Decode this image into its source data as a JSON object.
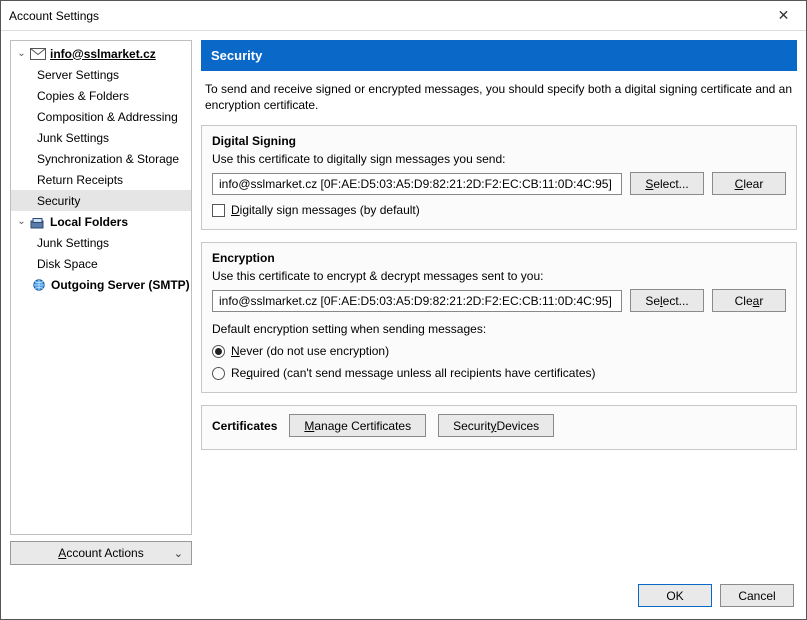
{
  "window": {
    "title": "Account Settings",
    "close_glyph": "✕"
  },
  "sidebar": {
    "account_email": "info@sslmarket.cz",
    "items": {
      "server_settings": "Server Settings",
      "copies_folders": "Copies & Folders",
      "composition_addressing": "Composition & Addressing",
      "junk_settings_acc": "Junk Settings",
      "sync_storage": "Synchronization & Storage",
      "return_receipts": "Return Receipts",
      "security": "Security",
      "local_folders": "Local Folders",
      "junk_settings_local": "Junk Settings",
      "disk_space": "Disk Space",
      "outgoing_smtp": "Outgoing Server (SMTP)"
    },
    "account_actions_label": "Account Actions",
    "twisty_down": "⌄",
    "chevron_down": "⌄"
  },
  "main": {
    "header": "Security",
    "intro": "To send and receive signed or encrypted messages, you should specify both a digital signing certificate and an encryption certificate.",
    "signing": {
      "title": "Digital Signing",
      "desc": "Use this certificate to digitally sign messages you send:",
      "cert": "info@sslmarket.cz [0F:AE:D5:03:A5:D9:82:21:2D:F2:EC:CB:11:0D:4C:95]",
      "select_label": "Select...",
      "clear_label": "Clear",
      "checkbox_label": "Digitally sign messages (by default)"
    },
    "encryption": {
      "title": "Encryption",
      "desc": "Use this certificate to encrypt & decrypt messages sent to you:",
      "cert": "info@sslmarket.cz [0F:AE:D5:03:A5:D9:82:21:2D:F2:EC:CB:11:0D:4C:95]",
      "select_label": "Select...",
      "clear_label": "Clear",
      "subhead": "Default encryption setting when sending messages:",
      "radio_never": "Never (do not use encryption)",
      "radio_required": "Required (can't send message unless all recipients have certificates)"
    },
    "certificates": {
      "label": "Certificates",
      "manage": "Manage Certificates",
      "devices": "Security Devices"
    }
  },
  "footer": {
    "ok": "OK",
    "cancel": "Cancel"
  }
}
